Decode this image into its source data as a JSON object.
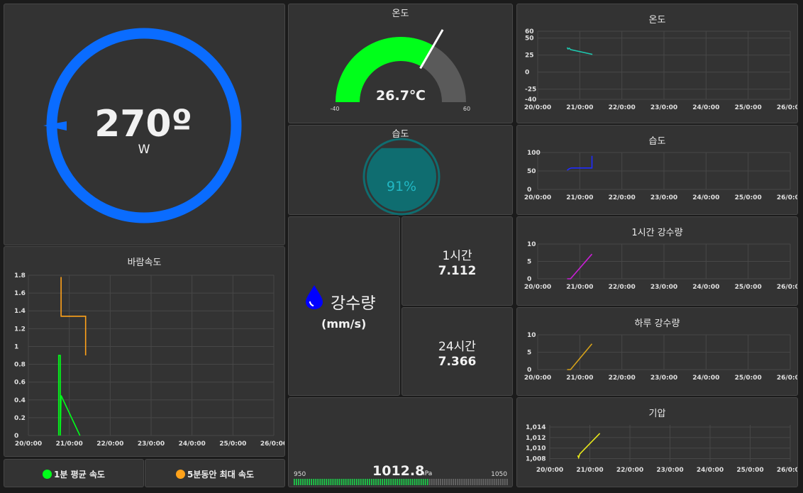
{
  "compass": {
    "value": "270º",
    "direction": "W"
  },
  "wind": {
    "title": "바람속도",
    "legend": [
      {
        "label": "1분 평균 속도",
        "color": "#00ff1a"
      },
      {
        "label": "5분동안 최대 속도",
        "color": "#ffa21a"
      }
    ]
  },
  "temp_gauge": {
    "title": "온도",
    "value": "26.7℃",
    "min": "-40",
    "max": "60",
    "level": 0.667
  },
  "humidity": {
    "title": "습도",
    "value": "91%",
    "level": 0.91
  },
  "rain": {
    "title": "강수량",
    "unit": "(mm/s)",
    "hour_label": "1시간",
    "hour_value": "7.112",
    "day_label": "24시간",
    "day_value": "7.366"
  },
  "pressure": {
    "value": "1012.8",
    "unit": "hPa",
    "min": "950",
    "max": "1050",
    "level": 0.628
  },
  "colors": {
    "panel": "#333333",
    "gauge_fill": "#00ff1a",
    "gauge_bg": "#5a5a5a",
    "compass": "#0a6cff",
    "humidity": "#0f6d70",
    "drop": "#0000ff"
  },
  "chart_data": [
    {
      "id": "wind",
      "type": "line",
      "x_ticks": [
        "20/0:00",
        "21/0:00",
        "22/0:00",
        "23/0:00",
        "24/0:00",
        "25/0:00",
        "26/0:00"
      ],
      "y_ticks": [
        "0",
        "0.2",
        "0.4",
        "0.6",
        "0.8",
        "1",
        "1.2",
        "1.4",
        "1.6",
        "1.8"
      ],
      "ylim": [
        0,
        1.8
      ],
      "series": [
        {
          "name": "1분 평균 속도",
          "color": "#00ff1a",
          "points": [
            [
              0.74,
              0
            ],
            [
              0.74,
              0.9
            ],
            [
              0.78,
              0.9
            ],
            [
              0.78,
              0
            ],
            [
              0.8,
              0.45
            ],
            [
              1.26,
              0
            ]
          ]
        },
        {
          "name": "5분동안 최대 속도",
          "color": "#ffa21a",
          "points": [
            [
              0.8,
              1.78
            ],
            [
              0.8,
              1.34
            ],
            [
              1.4,
              1.34
            ],
            [
              1.4,
              0.9
            ]
          ]
        }
      ]
    },
    {
      "id": "temp",
      "title": "온도",
      "type": "line",
      "x_ticks": [
        "20/0:00",
        "21/0:00",
        "22/0:00",
        "23/0:00",
        "24/0:00",
        "25/0:00",
        "26/0:00"
      ],
      "y_ticks": [
        "-40",
        "-25",
        "0",
        "25",
        "50",
        "60"
      ],
      "ylim": [
        -40,
        60
      ],
      "series": [
        {
          "color": "#1ec9b0",
          "points": [
            [
              0.7,
              36
            ],
            [
              0.72,
              34
            ],
            [
              0.75,
              35
            ],
            [
              0.78,
              33
            ],
            [
              1.3,
              26
            ]
          ]
        }
      ]
    },
    {
      "id": "humidity",
      "title": "습도",
      "type": "line",
      "x_ticks": [
        "20/0:00",
        "21/0:00",
        "22/0:00",
        "23/0:00",
        "24/0:00",
        "25/0:00",
        "26/0:00"
      ],
      "y_ticks": [
        "0",
        "50",
        "100"
      ],
      "ylim": [
        0,
        100
      ],
      "series": [
        {
          "color": "#1f2bff",
          "points": [
            [
              0.7,
              52
            ],
            [
              0.75,
              56
            ],
            [
              0.8,
              58
            ],
            [
              1.29,
              58
            ],
            [
              1.29,
              91
            ]
          ]
        }
      ]
    },
    {
      "id": "rain1h",
      "title": "1시간 강수량",
      "type": "line",
      "x_ticks": [
        "20/0:00",
        "21/0:00",
        "22/0:00",
        "23/0:00",
        "24/0:00",
        "25/0:00",
        "26/0:00"
      ],
      "y_ticks": [
        "0",
        "5",
        "10"
      ],
      "ylim": [
        0,
        10
      ],
      "series": [
        {
          "color": "#c91fd6",
          "points": [
            [
              0.7,
              0
            ],
            [
              0.78,
              0
            ],
            [
              1.29,
              7.1
            ]
          ]
        }
      ]
    },
    {
      "id": "rain24h",
      "title": "하루 강수량",
      "type": "line",
      "x_ticks": [
        "20/0:00",
        "21/0:00",
        "22/0:00",
        "23/0:00",
        "24/0:00",
        "25/0:00",
        "26/0:00"
      ],
      "y_ticks": [
        "0",
        "5",
        "10"
      ],
      "ylim": [
        0,
        10
      ],
      "series": [
        {
          "color": "#d6a21a",
          "points": [
            [
              0.7,
              0
            ],
            [
              0.78,
              0
            ],
            [
              1.29,
              7.4
            ]
          ]
        }
      ]
    },
    {
      "id": "pressure",
      "title": "기압",
      "type": "line",
      "x_ticks": [
        "20/0:00",
        "21/0:00",
        "22/0:00",
        "23/0:00",
        "24/0:00",
        "25/0:00",
        "26/0:00"
      ],
      "y_ticks": [
        "1,008",
        "1,010",
        "1,012",
        "1,014"
      ],
      "ylim": [
        1007.4,
        1014.4
      ],
      "series": [
        {
          "color": "#e8e81a",
          "points": [
            [
              0.7,
              1008.6
            ],
            [
              0.72,
              1008.2
            ],
            [
              0.75,
              1008.9
            ],
            [
              1.25,
              1012.8
            ]
          ]
        }
      ]
    }
  ]
}
